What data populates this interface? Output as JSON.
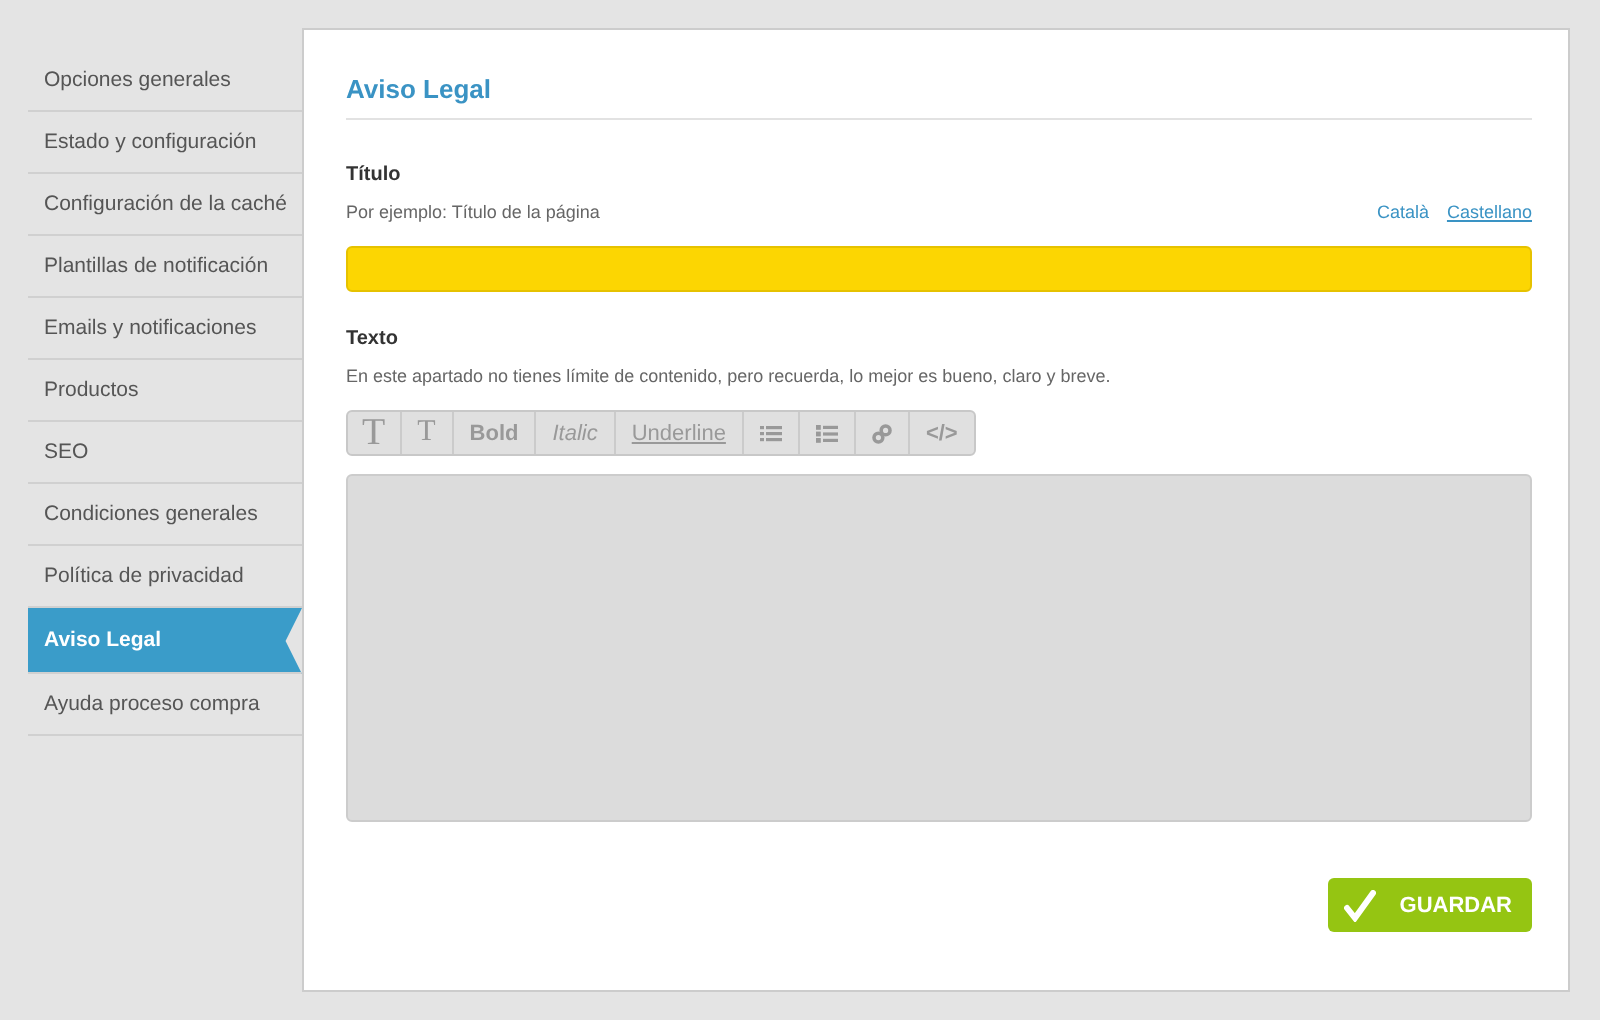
{
  "sidebar": {
    "items": [
      {
        "label": "Opciones generales",
        "selected": false
      },
      {
        "label": "Estado y configuración",
        "selected": false
      },
      {
        "label": "Configuración de la caché",
        "selected": false
      },
      {
        "label": "Plantillas de notificación",
        "selected": false
      },
      {
        "label": "Emails y notificaciones",
        "selected": false
      },
      {
        "label": "Productos",
        "selected": false
      },
      {
        "label": "SEO",
        "selected": false
      },
      {
        "label": "Condiciones generales",
        "selected": false
      },
      {
        "label": "Política de privacidad",
        "selected": false
      },
      {
        "label": "Aviso Legal",
        "selected": true
      },
      {
        "label": "Ayuda proceso compra",
        "selected": false
      }
    ]
  },
  "panel": {
    "title": "Aviso Legal",
    "title_field": {
      "label": "Título",
      "hint": "Por ejemplo: Título de la página",
      "languages": [
        {
          "label": "Català",
          "selected": true
        },
        {
          "label": "Castellano",
          "selected": false
        }
      ]
    },
    "text_field": {
      "label": "Texto",
      "hint": "En este apartado no tienes límite de contenido, pero recuerda, lo mejor es bueno, claro y breve.",
      "toolbar": [
        {
          "kind": "heading-large",
          "label": "T"
        },
        {
          "kind": "heading-small",
          "label": "T"
        },
        {
          "kind": "bold",
          "label": "Bold"
        },
        {
          "kind": "italic",
          "label": "Italic"
        },
        {
          "kind": "underline",
          "label": "Underline"
        },
        {
          "kind": "list"
        },
        {
          "kind": "numbered-list"
        },
        {
          "kind": "link"
        },
        {
          "kind": "code",
          "label": "</>"
        }
      ]
    },
    "save_button": "GUARDAR"
  }
}
